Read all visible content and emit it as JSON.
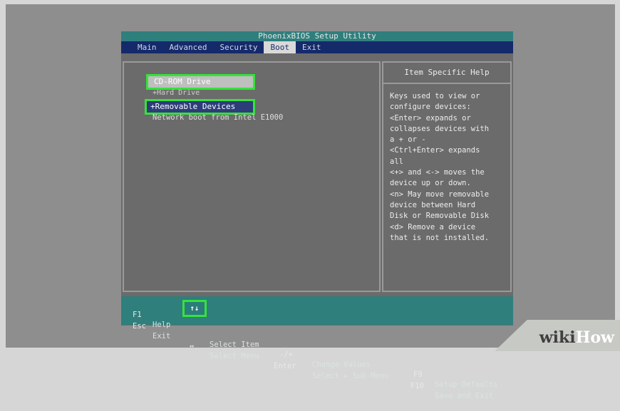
{
  "app": {
    "title": "PhoenixBIOS Setup Utility"
  },
  "menu": [
    {
      "label": "Main"
    },
    {
      "label": "Advanced"
    },
    {
      "label": "Security"
    },
    {
      "label": "Boot",
      "active": true
    },
    {
      "label": "Exit"
    }
  ],
  "boot_items": {
    "cdrom": "CD-ROM Drive",
    "hdd": "+Hard Drive",
    "removable": "+Removable Devices",
    "network": "Network boot from Intel E1000"
  },
  "help": {
    "title": "Item Specific Help",
    "lines": [
      "Keys used to view or",
      "configure devices:",
      "<Enter> expands or",
      "collapses devices with",
      "a + or -",
      "<Ctrl+Enter> expands",
      "all",
      "<+> and <-> moves the",
      "device up or down.",
      "<n> May move removable",
      "device between Hard",
      "Disk or Removable Disk",
      "<d> Remove a device",
      "that is not installed."
    ]
  },
  "footer": {
    "row1": {
      "k1": "F1",
      "a1": "Help",
      "k2": "↑↓",
      "a2": "Select Item",
      "k3": "-/+",
      "a3": "Change Values",
      "k4": "F9",
      "a4": "Setup Defaults"
    },
    "row2": {
      "k1": "Esc",
      "a1": "Exit",
      "k2": "↔",
      "a2": "Select Menu",
      "k3": "Enter",
      "a3": "Select ▸ Sub-Menu",
      "k4": "F10",
      "a4": "Save and Exit"
    }
  },
  "watermark": {
    "wiki": "wiki",
    "how": "How"
  },
  "colors": {
    "title_bar": "#2f7f7d",
    "menu_bar": "#152a6b",
    "highlight": "#36e23a",
    "panel": "#6b6b6b"
  }
}
